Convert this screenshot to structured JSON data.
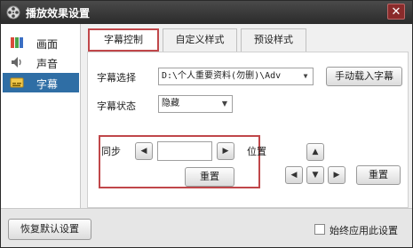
{
  "window": {
    "title": "播放效果设置",
    "close_label": "✕"
  },
  "sidebar": {
    "items": [
      {
        "label": "画面",
        "icon": "screen-icon",
        "active": false
      },
      {
        "label": "声音",
        "icon": "speaker-icon",
        "active": false
      },
      {
        "label": "字幕",
        "icon": "subtitle-icon",
        "active": true
      }
    ]
  },
  "tabs": [
    {
      "label": "字幕控制",
      "active": true
    },
    {
      "label": "自定义样式",
      "active": false
    },
    {
      "label": "预设样式",
      "active": false
    }
  ],
  "subtitle_control": {
    "select_label": "字幕选择",
    "select_value": "D:\\个人重要资料(勿删)\\Adv",
    "load_button": "手动载入字幕",
    "status_label": "字幕状态",
    "status_value": "隐藏",
    "sync_label": "同步",
    "sync_value": "",
    "sync_reset": "重置",
    "position_label": "位置",
    "position_reset": "重置"
  },
  "bottom": {
    "restore_button": "恢复默认设置",
    "always_apply_label": "始终应用此设置",
    "always_apply_checked": false
  },
  "colors": {
    "titlebar": "#333333",
    "active_sidebar": "#2f6ea5",
    "highlight_border": "#c0474a"
  }
}
